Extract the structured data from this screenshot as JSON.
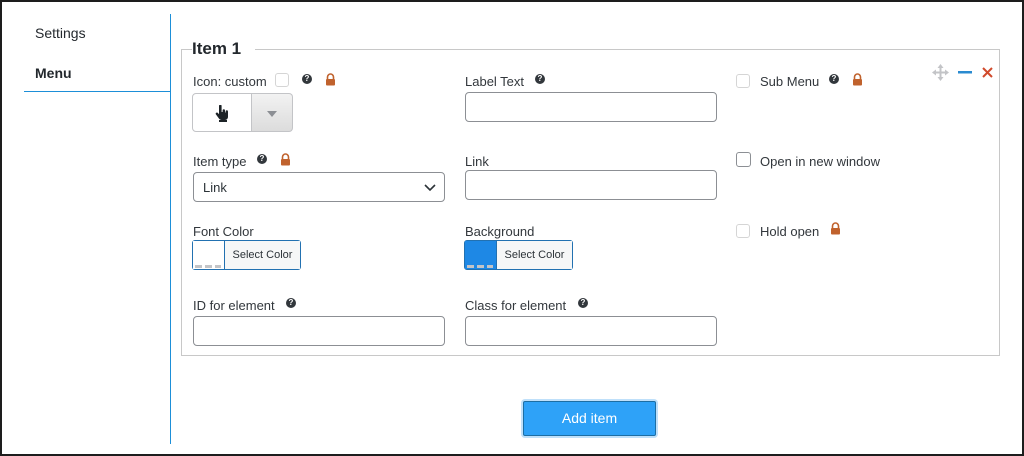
{
  "sidebar": {
    "items": [
      {
        "label": "Settings",
        "active": false
      },
      {
        "label": "Menu",
        "active": true
      }
    ]
  },
  "item": {
    "title": "Item 1",
    "icon_label": "Icon: custom",
    "label_text_label": "Label Text",
    "label_text_value": "",
    "sub_menu_label": "Sub Menu",
    "item_type_label": "Item type",
    "item_type_value": "Link",
    "link_label": "Link",
    "link_value": "",
    "open_new_window_label": "Open in new window",
    "font_color_label": "Font Color",
    "font_color_button": "Select Color",
    "background_label": "Background",
    "background_button": "Select Color",
    "hold_open_label": "Hold open",
    "id_label": "ID for element",
    "id_value": "",
    "class_label": "Class for element",
    "class_value": ""
  },
  "colors": {
    "accent": "#2ea2f8",
    "background_swatch": "#1e88e5",
    "font_color_swatch": "#ffffff",
    "lock": "#c0622d",
    "remove": "#d04a2b",
    "collapse": "#2a8bd0"
  },
  "icons": {
    "selected_icon": "hand-pointer-icon",
    "move": "move-arrows-icon",
    "collapse": "minus-icon",
    "remove": "close-icon"
  },
  "actions": {
    "add_item": "Add item"
  }
}
